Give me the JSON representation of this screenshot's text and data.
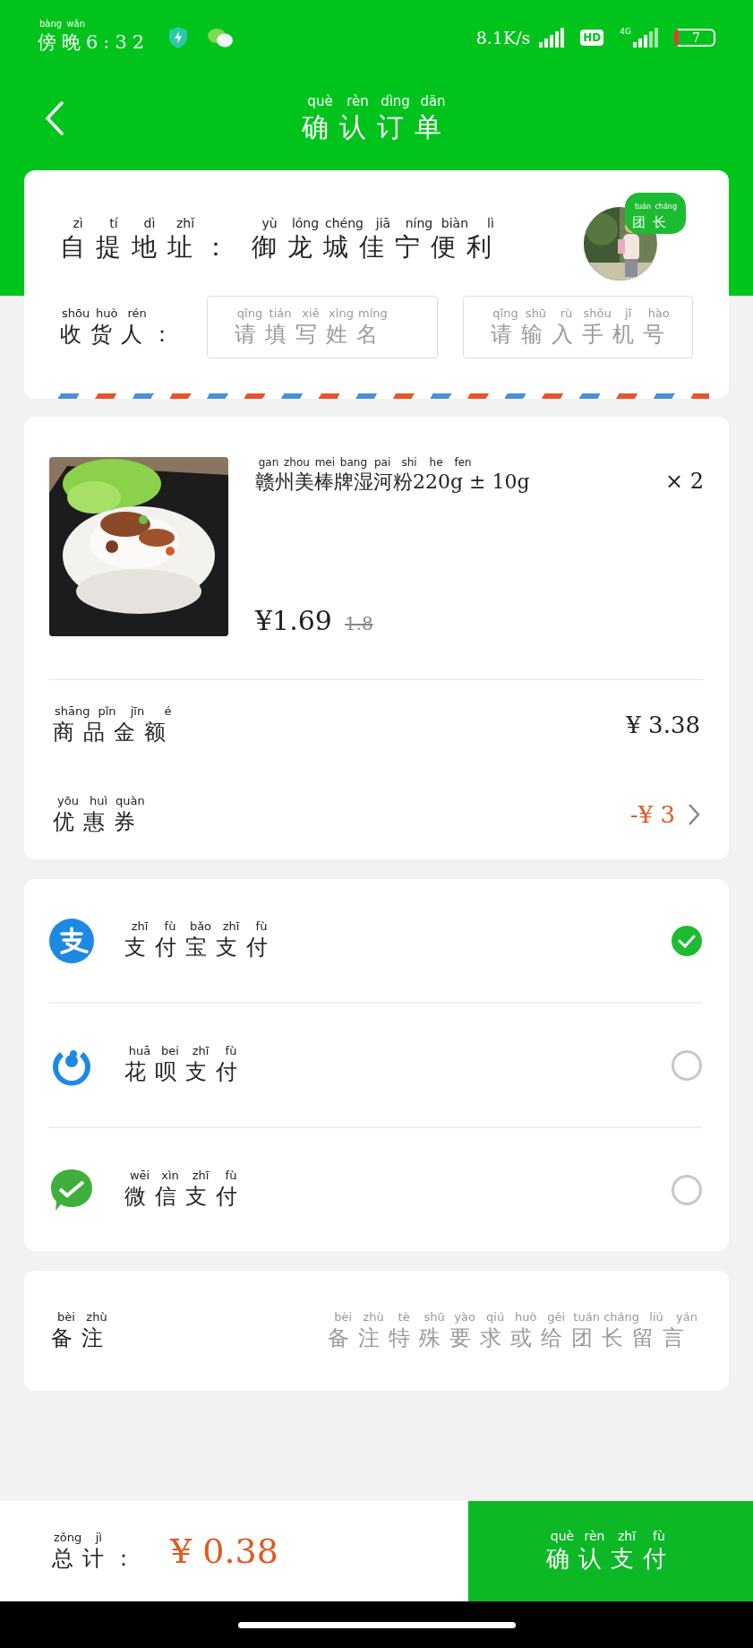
{
  "status_bar": {
    "time": {
      "text": "傍晚6:32",
      "pinyin": "bàng wǎn"
    },
    "network_speed": "8.1K/s",
    "hd_badge": "HD",
    "network_type": "4G",
    "battery": "7"
  },
  "header": {
    "title": {
      "text": "确认订单",
      "pinyin": "què rèn dìng dān"
    }
  },
  "pickup": {
    "label": {
      "text": "自提地址：",
      "pinyin": "zì tí dì zhǐ"
    },
    "address": {
      "text": "御龙城佳宁便利",
      "pinyin": "yù lóng chéng jiā níng biàn lì"
    },
    "leader_badge": {
      "text": "团长",
      "pinyin": "tuán cháng"
    }
  },
  "receiver": {
    "label": {
      "text": "收货人：",
      "pinyin": "shōu huò rén"
    },
    "name_field": {
      "placeholder": {
        "text": "请填写姓名",
        "pinyin": "qǐng tián xiě xìng míng"
      }
    },
    "phone_field": {
      "placeholder": {
        "text": "请输入手机号",
        "pinyin": "qǐng shū rù shǒu jī hào"
      }
    }
  },
  "product": {
    "name": {
      "text": "赣州美棒牌湿河粉220g ± 10g",
      "pinyin": "gan zhou mei bang pai shi he fen"
    },
    "quantity": "× 2",
    "price": "¥1.69",
    "original_price": "1.8"
  },
  "summary": [
    {
      "kind": "amount",
      "label": {
        "text": "商品金额",
        "pinyin": "shāng pǐn jīn é"
      },
      "value": "¥ 3.38"
    },
    {
      "kind": "coupon",
      "label": {
        "text": "优惠券",
        "pinyin": "yōu huì quàn"
      },
      "value": "-¥ 3"
    }
  ],
  "payment_methods": [
    {
      "kind": "alipay",
      "label": {
        "text": "支付宝支付",
        "pinyin": "zhī fù bǎo zhī fù"
      },
      "selected": true
    },
    {
      "kind": "huabei",
      "label": {
        "text": "花呗支付",
        "pinyin": "huā bei zhī fù"
      },
      "selected": false
    },
    {
      "kind": "wechat",
      "label": {
        "text": "微信支付",
        "pinyin": "wēi xìn zhī fù"
      },
      "selected": false
    }
  ],
  "remark": {
    "label": {
      "text": "备注",
      "pinyin": "bèi zhù"
    },
    "placeholder": {
      "text": "备注特殊要求或给团长留言",
      "pinyin": "bèi zhù tè shū yào qiú huò gěi tuán cháng liú yán"
    }
  },
  "footer": {
    "total_label": {
      "text": "总计：",
      "pinyin": "zǒng jì"
    },
    "total": "¥ 0.38",
    "confirm_button": {
      "text": "确认支付",
      "pinyin": "què rèn zhī fù"
    }
  }
}
